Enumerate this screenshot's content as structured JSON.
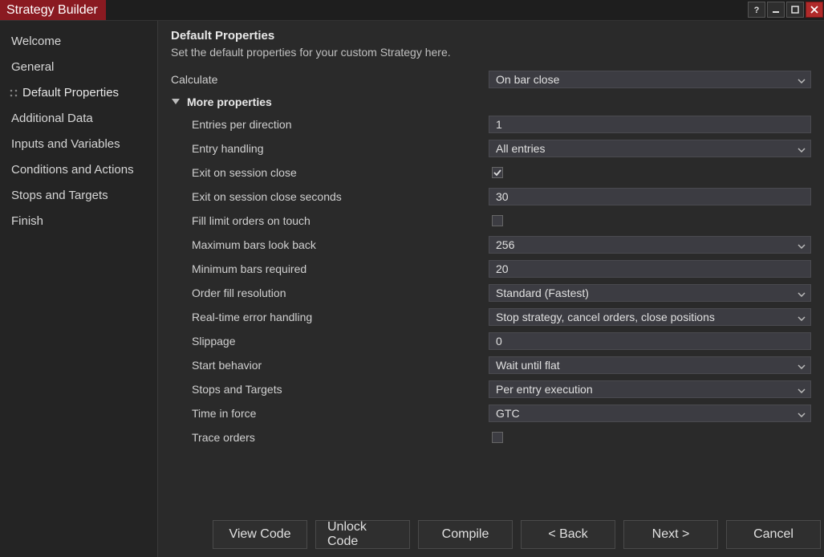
{
  "window": {
    "title": "Strategy Builder"
  },
  "sidebar": {
    "items": [
      {
        "label": "Welcome",
        "active": false
      },
      {
        "label": "General",
        "active": false
      },
      {
        "label": "Default Properties",
        "active": true
      },
      {
        "label": "Additional Data",
        "active": false
      },
      {
        "label": "Inputs and Variables",
        "active": false
      },
      {
        "label": "Conditions and Actions",
        "active": false
      },
      {
        "label": "Stops and Targets",
        "active": false
      },
      {
        "label": "Finish",
        "active": false
      }
    ]
  },
  "content": {
    "heading": "Default Properties",
    "subtext": "Set the default properties for your custom Strategy here.",
    "calculate_label": "Calculate",
    "calculate_value": "On bar close",
    "section_label": "More properties",
    "props": {
      "entries_per_direction_label": "Entries per direction",
      "entries_per_direction_value": "1",
      "entry_handling_label": "Entry handling",
      "entry_handling_value": "All entries",
      "exit_on_session_close_label": "Exit on session close",
      "exit_on_session_close_checked": true,
      "exit_on_session_close_seconds_label": "Exit on session close seconds",
      "exit_on_session_close_seconds_value": "30",
      "fill_limit_orders_label": "Fill limit orders on touch",
      "fill_limit_orders_checked": false,
      "max_bars_look_back_label": "Maximum bars look back",
      "max_bars_look_back_value": "256",
      "min_bars_required_label": "Minimum bars required",
      "min_bars_required_value": "20",
      "order_fill_resolution_label": "Order fill resolution",
      "order_fill_resolution_value": "Standard (Fastest)",
      "realtime_error_handling_label": "Real-time error handling",
      "realtime_error_handling_value": "Stop strategy, cancel orders, close positions",
      "slippage_label": "Slippage",
      "slippage_value": "0",
      "start_behavior_label": "Start behavior",
      "start_behavior_value": "Wait until flat",
      "stops_targets_label": "Stops and Targets",
      "stops_targets_value": "Per entry execution",
      "time_in_force_label": "Time in force",
      "time_in_force_value": "GTC",
      "trace_orders_label": "Trace orders",
      "trace_orders_checked": false
    }
  },
  "footer": {
    "view_code": "View Code",
    "unlock_code": "Unlock Code",
    "compile": "Compile",
    "back": "< Back",
    "next": "Next >",
    "cancel": "Cancel"
  }
}
